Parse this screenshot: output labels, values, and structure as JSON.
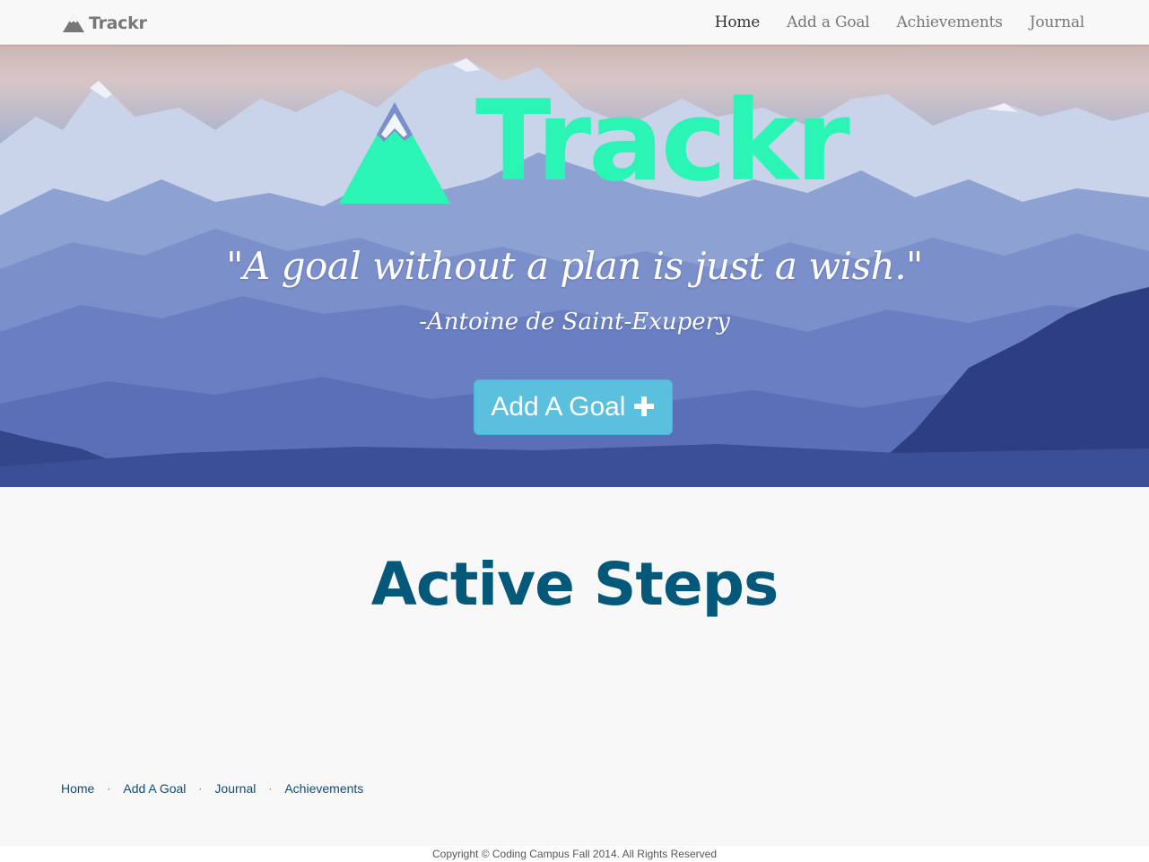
{
  "navbar": {
    "brand": "Trackr",
    "links": [
      {
        "label": "Home",
        "active": true
      },
      {
        "label": "Add a Goal",
        "active": false
      },
      {
        "label": "Achievements",
        "active": false
      },
      {
        "label": "Journal",
        "active": false
      }
    ]
  },
  "hero": {
    "title": "Trackr",
    "quote": "\"A goal without a plan is just a wish.\"",
    "author": "-Antoine de Saint-Exupery",
    "button_label": "Add A Goal",
    "button_icon": "plus-icon"
  },
  "main": {
    "section_title": "Active Steps"
  },
  "footer": {
    "links": [
      "Home",
      "Add A Goal",
      "Journal",
      "Achievements"
    ],
    "copyright": "Copyright © Coding Campus Fall 2014. All Rights Reserved"
  },
  "colors": {
    "accent": "#2af5b4",
    "button": "#5bc0de",
    "heading": "#04587a",
    "footer_link": "#0e4e76"
  }
}
